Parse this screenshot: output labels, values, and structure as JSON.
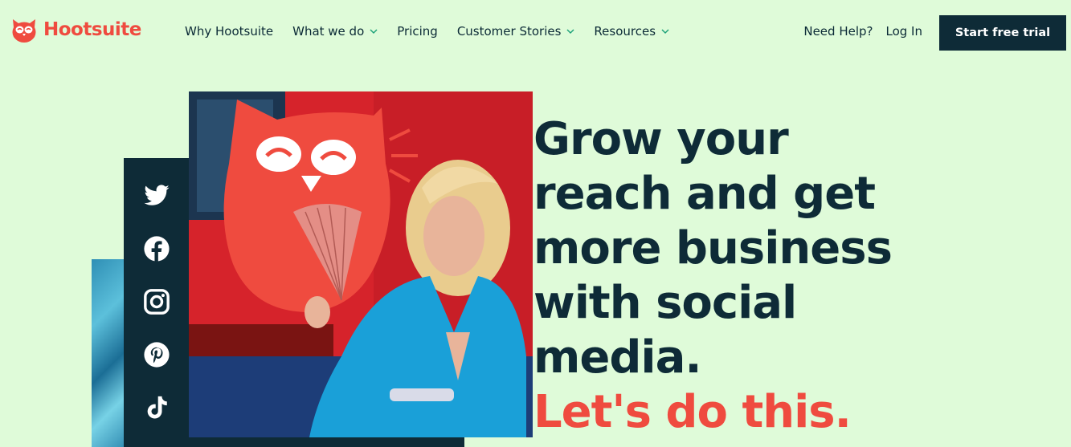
{
  "brand": {
    "name": "Hootsuite",
    "accent": "#ef4b3f",
    "dark": "#0e2b37",
    "background": "#dffbd9"
  },
  "nav": {
    "items": [
      {
        "label": "Why Hootsuite",
        "dropdown": false
      },
      {
        "label": "What we do",
        "dropdown": true
      },
      {
        "label": "Pricing",
        "dropdown": false
      },
      {
        "label": "Customer Stories",
        "dropdown": true
      },
      {
        "label": "Resources",
        "dropdown": true
      }
    ],
    "help": "Need Help?",
    "login": "Log In",
    "cta": "Start free trial"
  },
  "hero": {
    "headline_lines": [
      "Grow your",
      "reach and get",
      "more business",
      "with social",
      "media."
    ],
    "tagline": "Let's do this.",
    "social_icons": [
      "twitter-icon",
      "facebook-icon",
      "instagram-icon",
      "pinterest-icon",
      "tiktok-icon"
    ]
  }
}
